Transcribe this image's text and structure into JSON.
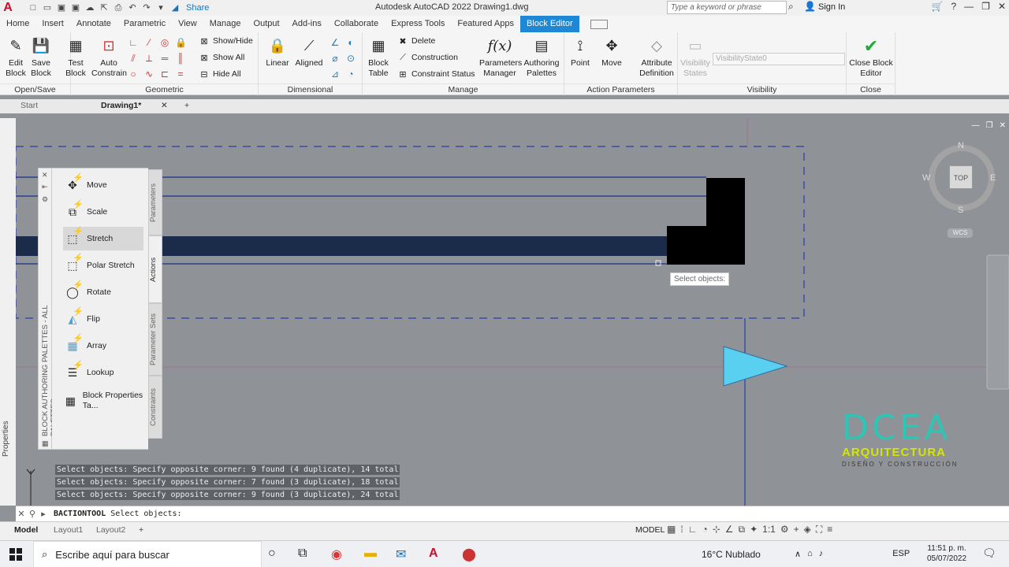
{
  "titlebar": {
    "app": "A",
    "share": "Share",
    "title": "Autodesk AutoCAD 2022   Drawing1.dwg",
    "search_placeholder": "Type a keyword or phrase",
    "signin": "Sign In"
  },
  "tabs": [
    "Home",
    "Insert",
    "Annotate",
    "Parametric",
    "View",
    "Manage",
    "Output",
    "Add-ins",
    "Collaborate",
    "Express Tools",
    "Featured Apps",
    "Block Editor"
  ],
  "ribbon": {
    "edit_block": "Edit Block",
    "save_block": "Save Block",
    "test_block": "Test Block",
    "auto_constrain": "Auto Constrain",
    "show_hide": "Show/Hide",
    "show_all": "Show All",
    "hide_all": "Hide All",
    "linear": "Linear",
    "aligned": "Aligned",
    "block_table": "Block Table",
    "delete": "Delete",
    "construction": "Construction",
    "constraint_status": "Constraint Status",
    "parameters_manager": "Parameters Manager",
    "authoring_palettes": "Authoring Palettes",
    "point": "Point",
    "move": "Move",
    "attribute_definition": "Attribute Definition",
    "visibility_states": "Visibility States",
    "visibility_dd": "VisibilityState0",
    "close_block_editor": "Close Block Editor",
    "panels": {
      "open_save": "Open/Save",
      "geometric": "Geometric",
      "dimensional": "Dimensional",
      "manage": "Manage",
      "action_parameters": "Action Parameters",
      "visibility": "Visibility",
      "close": "Close"
    }
  },
  "filetabs": {
    "start": "Start",
    "drawing": "Drawing1*"
  },
  "properties_label": "Properties",
  "palette": {
    "title": "BLOCK AUTHORING PALETTES - ALL PALETTES",
    "tabs": [
      "Parameters",
      "Actions",
      "Parameter Sets",
      "Constraints"
    ],
    "items": [
      "Move",
      "Scale",
      "Stretch",
      "Polar Stretch",
      "Rotate",
      "Flip",
      "Array",
      "Lookup",
      "Block Properties Ta..."
    ]
  },
  "viewcube": {
    "n": "N",
    "s": "S",
    "e": "E",
    "w": "W",
    "top": "TOP",
    "wcs": "WCS"
  },
  "tooltip": "Select objects:",
  "cmd_history": [
    "Select objects: Specify opposite corner: 9 found (4 duplicate), 14 total",
    "Select objects: Specify opposite corner: 7 found (3 duplicate), 18 total",
    "Select objects: Specify opposite corner: 9 found (3 duplicate), 24 total"
  ],
  "cmdline": {
    "cmd": "BACTIONTOOL",
    "prompt": "Select objects:"
  },
  "layouts": [
    "Model",
    "Layout1",
    "Layout2"
  ],
  "status": {
    "model": "MODEL",
    "scale": "1:1"
  },
  "watermark": {
    "logo": "DCEA",
    "sub": "ARQUITECTURA",
    "tag": "DISEÑO Y CONSTRUCCIÓN"
  },
  "taskbar": {
    "search": "Escribe aquí para buscar",
    "weather": "16°C  Nublado",
    "lang": "ESP",
    "time": "11:51 p. m.",
    "date": "05/07/2022"
  }
}
